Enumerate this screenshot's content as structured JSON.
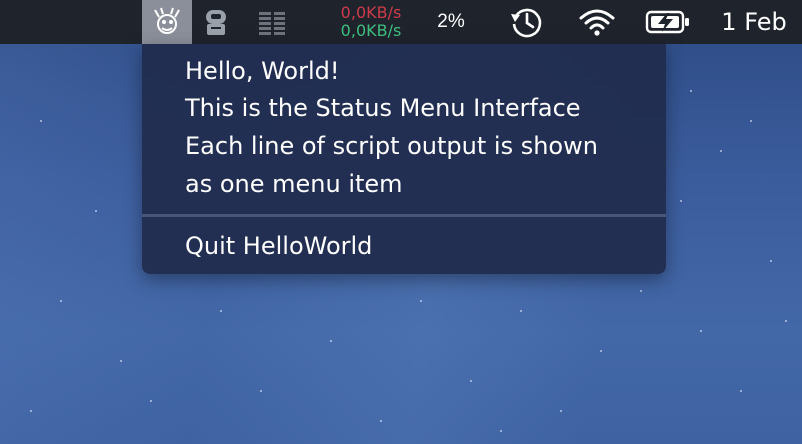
{
  "menubar": {
    "network": {
      "upload": "0,0KB/s",
      "download": "0,0KB/s"
    },
    "cpu": "2%",
    "date": "1 Feb",
    "icons": [
      "lobster-app-icon",
      "robot-icon",
      "stack-icon",
      "time-machine-icon",
      "wifi-icon",
      "battery-charging-icon"
    ]
  },
  "menu": {
    "lines": [
      "Hello, World!",
      "This is the Status Menu Interface",
      "Each line of script output is shown",
      "as one menu item"
    ],
    "quit_label": "Quit HelloWorld"
  },
  "colors": {
    "menubar": "#1f232c",
    "menu_bg": "#212d4f",
    "upload": "#cc3b4a",
    "download": "#3fbf7f"
  }
}
